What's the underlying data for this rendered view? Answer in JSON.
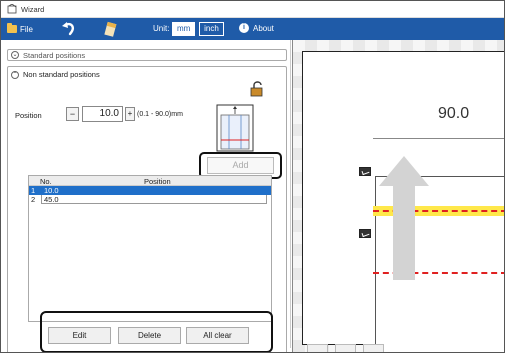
{
  "window": {
    "title": "Wizard"
  },
  "toolbar": {
    "file_label": "File",
    "unit_label": "Unit:",
    "unit_mm": "mm",
    "unit_inch": "inch",
    "selected_unit": "mm",
    "about_label": "About",
    "about_icon_glyph": "i"
  },
  "panel": {
    "standard_positions": "Standard positions",
    "non_standard_positions": "Non standard positions",
    "position_label": "Position",
    "position_value": "10.0",
    "minus_label": "−",
    "plus_label": "+",
    "range_label": "(0.1 - 90.0)mm",
    "add_label": "Add",
    "list": {
      "col_no": "No.",
      "col_position": "Position",
      "rows": [
        {
          "no": "1",
          "position": "10.0",
          "selected": true
        },
        {
          "no": "2",
          "position": "45.0",
          "selected": false
        }
      ]
    },
    "buttons": {
      "edit": "Edit",
      "delete": "Delete",
      "all_clear": "All clear"
    }
  },
  "canvas": {
    "dimension_value": "90.0"
  },
  "colors": {
    "toolbar_bg": "#1f5ba8",
    "selection": "#1f6fc9",
    "guide_line": "#e02020",
    "highlight_band": "#ffe84a"
  },
  "icons": {
    "window": "wizard-window-icon",
    "file": "folder-icon",
    "undo": "undo-icon",
    "clear": "eraser-icon",
    "about": "info-icon",
    "lock": "lock-icon"
  }
}
